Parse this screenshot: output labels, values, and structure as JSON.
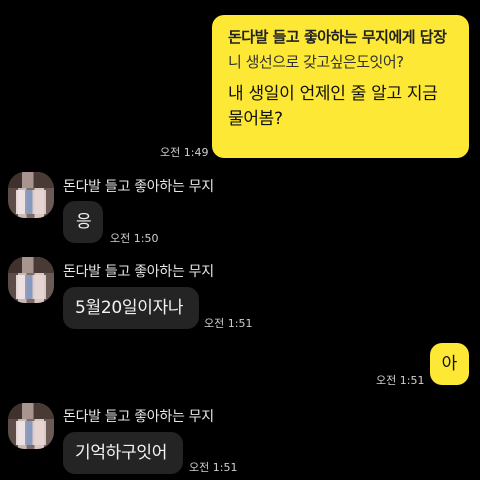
{
  "messages": {
    "reply": {
      "title": "돈다발 들고 좋아하는 무지에게 답장",
      "quote": "니 생선으로 갖고싶은도잇어?",
      "text": "내 생일이 언제인 줄 알고 지금 물어봄?",
      "time": "오전 1:49"
    },
    "m1": {
      "sender": "돈다발 들고 좋아하는 무지",
      "text": "응",
      "time": "오전 1:50"
    },
    "m2": {
      "sender": "돈다발 들고 좋아하는 무지",
      "text": "5월20일이자나",
      "time": "오전 1:51"
    },
    "m3": {
      "text": "아",
      "time": "오전 1:51"
    },
    "m4": {
      "sender": "돈다발 들고 좋아하는 무지",
      "text": "기억하구잇어",
      "time": "오전 1:51"
    }
  },
  "colors": {
    "background": "#000000",
    "my_bubble": "#fde835",
    "other_bubble": "#242424"
  }
}
